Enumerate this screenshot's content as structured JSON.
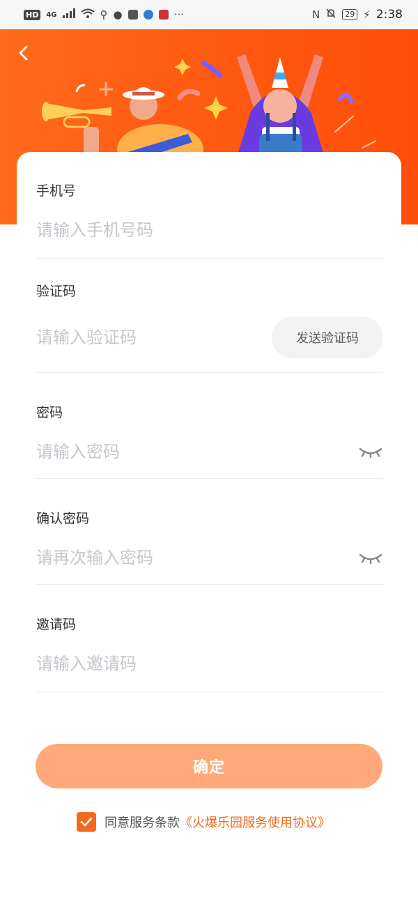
{
  "status_bar": {
    "hd": "HD",
    "network": "4G",
    "battery": "29",
    "time": "2:38",
    "icons": [
      "signal-icon",
      "wifi-icon",
      "usb-icon",
      "wechat-icon",
      "shield-icon",
      "browser-icon",
      "app-icon",
      "more-icon",
      "nfc-icon",
      "mute-icon",
      "charging-icon"
    ],
    "more": "···"
  },
  "header": {
    "back_icon": "chevron-left-icon",
    "colors": {
      "gradient_start": "#ff6a1c",
      "gradient_end": "#ff4e0a"
    }
  },
  "form": {
    "phone": {
      "label": "手机号",
      "placeholder": "请输入手机号码"
    },
    "code": {
      "label": "验证码",
      "placeholder": "请输入验证码",
      "send_button": "发送验证码"
    },
    "password": {
      "label": "密码",
      "placeholder": "请输入密码",
      "toggle_icon": "eye-closed-icon"
    },
    "confirm_password": {
      "label": "确认密码",
      "placeholder": "请再次输入密码",
      "toggle_icon": "eye-closed-icon"
    },
    "invite": {
      "label": "邀请码",
      "placeholder": "请输入邀请码"
    }
  },
  "actions": {
    "confirm_label": "确定",
    "agree_checked": true,
    "agree_text": "同意服务条款",
    "agree_link": "《火爆乐园服务使用协议》"
  },
  "colors": {
    "accent": "#f26a1b",
    "button": "#ffa87a",
    "placeholder": "#c4c7cc"
  }
}
